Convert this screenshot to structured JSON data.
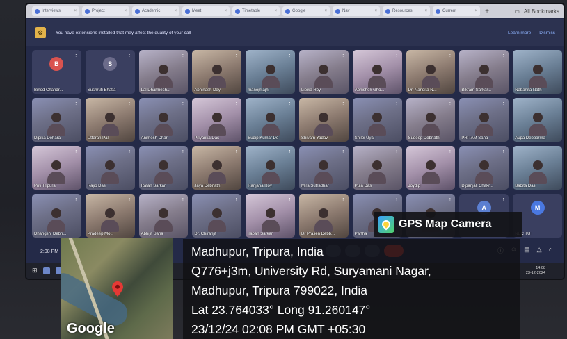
{
  "browser": {
    "tabs": [
      "Interviews",
      "Project",
      "Academic",
      "Meet",
      "Timetable",
      "Google",
      "Nav",
      "Resources",
      "Current"
    ],
    "new_tab": "+",
    "window_label": "All Bookmarks"
  },
  "banner": {
    "text": "You have extensions installed that may affect the quality of your call",
    "learn_more": "Learn more",
    "dismiss": "Dismiss"
  },
  "participants": [
    {
      "name": "Binod Chandr...",
      "avatar": "B",
      "avatar_color": "#d9534f",
      "camera": false
    },
    {
      "name": "Sushruti Bhatia",
      "avatar": "S",
      "avatar_color": "#6b6b8a",
      "camera": false
    },
    {
      "name": "Lal Dharmesh...",
      "camera": true
    },
    {
      "name": "Abhinash Dey",
      "camera": true
    },
    {
      "name": "manojmajhi",
      "camera": true
    },
    {
      "name": "Lipika Roy",
      "camera": true
    },
    {
      "name": "Abhishek Gho...",
      "camera": true
    },
    {
      "name": "Dr. Nandita N...",
      "camera": true
    },
    {
      "name": "Bikram Sarkar...",
      "camera": true
    },
    {
      "name": "Nabanita Nath",
      "camera": true
    },
    {
      "name": "Dipika Dehara",
      "camera": true
    },
    {
      "name": "Uttaran Pal",
      "camera": true
    },
    {
      "name": "Animesh Dhar",
      "camera": true
    },
    {
      "name": "Priyanka Das",
      "camera": true
    },
    {
      "name": "Sudip Kumar De",
      "camera": true
    },
    {
      "name": "Shivam Yadav",
      "camera": true
    },
    {
      "name": "Shilpi Uyal",
      "camera": true
    },
    {
      "name": "Sudeep Debnath",
      "camera": true
    },
    {
      "name": "PRITAM Saha",
      "camera": true
    },
    {
      "name": "Aupa Debbarma",
      "camera": true
    },
    {
      "name": "Priti Tripura",
      "camera": true
    },
    {
      "name": "Rajib Das",
      "camera": true
    },
    {
      "name": "Ratan Sarkar",
      "camera": true
    },
    {
      "name": "Jaya Debnath",
      "camera": true
    },
    {
      "name": "Ranjana Roy",
      "camera": true
    },
    {
      "name": "Mira Sutradhar",
      "camera": true
    },
    {
      "name": "Puja Das",
      "camera": true
    },
    {
      "name": "Joydip",
      "camera": true
    },
    {
      "name": "Dipanjali Chakr...",
      "camera": true
    },
    {
      "name": "Babita Das",
      "camera": true
    },
    {
      "name": "Dhangshi Debn...",
      "camera": true
    },
    {
      "name": "Pradeep Mo...",
      "camera": true
    },
    {
      "name": "Abhijit Saha",
      "camera": true
    },
    {
      "name": "Dr. Chiranjit",
      "camera": true
    },
    {
      "name": "Tapan Sarkar",
      "camera": true
    },
    {
      "name": "Dr Prasen Debb...",
      "camera": true
    },
    {
      "name": "Partha",
      "camera": true
    },
    {
      "name": "",
      "camera": true
    },
    {
      "name": "",
      "avatar": "A",
      "avatar_color": "#5b7fd1",
      "camera": false
    },
    {
      "name": "NEC TU",
      "avatar": "M",
      "avatar_color": "#4a78e0",
      "camera": false
    }
  ],
  "meet_bar": {
    "time": "2:08 PM"
  },
  "taskbar": {
    "clock_time": "14:08",
    "clock_date": "23-12-2024"
  },
  "gps": {
    "badge": "GPS Map Camera",
    "line1": "Madhupur, Tripura, India",
    "line2": "Q776+j3m, University Rd, Suryamani Nagar,",
    "line3": "Madhupur, Tripura 799022, India",
    "line4": "Lat 23.764033° Long 91.260147°",
    "line5": "23/12/24 02:08 PM GMT +05:30",
    "map_brand": "Google"
  }
}
